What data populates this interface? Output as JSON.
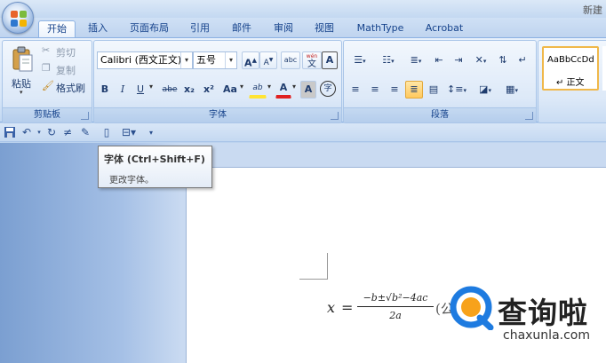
{
  "window": {
    "title": "新建"
  },
  "tabs": [
    {
      "label": "开始",
      "active": true
    },
    {
      "label": "插入"
    },
    {
      "label": "页面布局"
    },
    {
      "label": "引用"
    },
    {
      "label": "邮件"
    },
    {
      "label": "审阅"
    },
    {
      "label": "视图"
    },
    {
      "label": "MathType"
    },
    {
      "label": "Acrobat"
    }
  ],
  "clipboard": {
    "paste": "粘贴",
    "cut": "剪切",
    "copy": "复制",
    "format_painter": "格式刷",
    "group_label": "剪贴板"
  },
  "font": {
    "font_name": "Calibri (西文正文)",
    "font_size": "五号",
    "grow": "A",
    "shrink": "A",
    "clear_label": "abc",
    "phonetic": "wén",
    "phonetic_char": "文",
    "border_char": "A",
    "bold": "B",
    "italic": "I",
    "underline": "U",
    "strike": "abe",
    "subscript": "x₂",
    "superscript": "x²",
    "case": "Aa",
    "highlight": "ab",
    "font_color": "A",
    "shading": "A",
    "enclose": "字",
    "group_label": "字体"
  },
  "paragraph": {
    "group_label": "段落"
  },
  "styles": {
    "preview": "AaBbCcDd",
    "normal": "↵ 正文"
  },
  "tooltip": {
    "title": "字体 (Ctrl+Shift+F)",
    "body": "更改字体。"
  },
  "formula": {
    "lhs": "x",
    "equals": "=",
    "numerator": "−b±√b²−4ac",
    "denominator": "2a",
    "tail": "(公"
  },
  "watermark": {
    "text": "查询啦",
    "url": "chaxunla.com"
  },
  "colors": {
    "accent": "#15428b",
    "ribbon_border": "#8db2e3",
    "highlight_yellow": "#ffe433",
    "font_red": "#e02020"
  }
}
